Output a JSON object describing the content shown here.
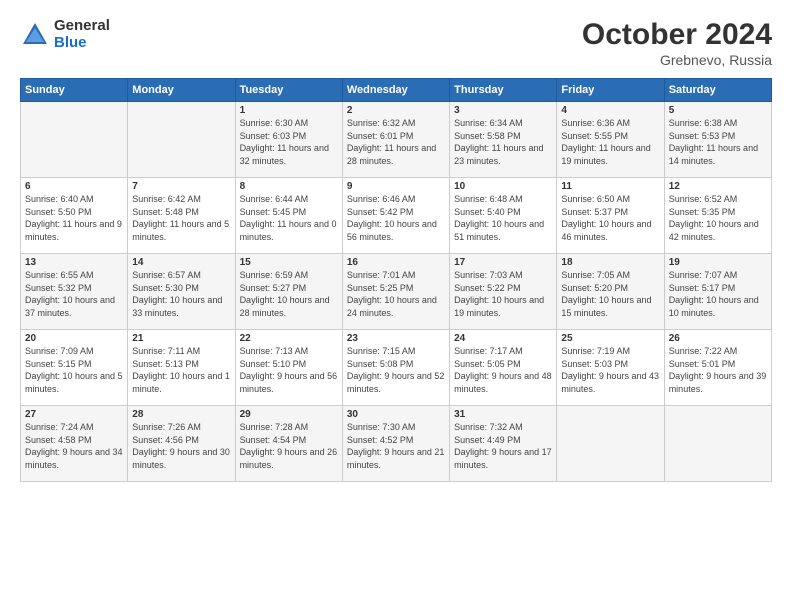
{
  "header": {
    "logo_general": "General",
    "logo_blue": "Blue",
    "month_title": "October 2024",
    "location": "Grebnevo, Russia"
  },
  "days_of_week": [
    "Sunday",
    "Monday",
    "Tuesday",
    "Wednesday",
    "Thursday",
    "Friday",
    "Saturday"
  ],
  "weeks": [
    [
      {
        "day": "",
        "sunrise": "",
        "sunset": "",
        "daylight": ""
      },
      {
        "day": "",
        "sunrise": "",
        "sunset": "",
        "daylight": ""
      },
      {
        "day": "1",
        "sunrise": "Sunrise: 6:30 AM",
        "sunset": "Sunset: 6:03 PM",
        "daylight": "Daylight: 11 hours and 32 minutes."
      },
      {
        "day": "2",
        "sunrise": "Sunrise: 6:32 AM",
        "sunset": "Sunset: 6:01 PM",
        "daylight": "Daylight: 11 hours and 28 minutes."
      },
      {
        "day": "3",
        "sunrise": "Sunrise: 6:34 AM",
        "sunset": "Sunset: 5:58 PM",
        "daylight": "Daylight: 11 hours and 23 minutes."
      },
      {
        "day": "4",
        "sunrise": "Sunrise: 6:36 AM",
        "sunset": "Sunset: 5:55 PM",
        "daylight": "Daylight: 11 hours and 19 minutes."
      },
      {
        "day": "5",
        "sunrise": "Sunrise: 6:38 AM",
        "sunset": "Sunset: 5:53 PM",
        "daylight": "Daylight: 11 hours and 14 minutes."
      }
    ],
    [
      {
        "day": "6",
        "sunrise": "Sunrise: 6:40 AM",
        "sunset": "Sunset: 5:50 PM",
        "daylight": "Daylight: 11 hours and 9 minutes."
      },
      {
        "day": "7",
        "sunrise": "Sunrise: 6:42 AM",
        "sunset": "Sunset: 5:48 PM",
        "daylight": "Daylight: 11 hours and 5 minutes."
      },
      {
        "day": "8",
        "sunrise": "Sunrise: 6:44 AM",
        "sunset": "Sunset: 5:45 PM",
        "daylight": "Daylight: 11 hours and 0 minutes."
      },
      {
        "day": "9",
        "sunrise": "Sunrise: 6:46 AM",
        "sunset": "Sunset: 5:42 PM",
        "daylight": "Daylight: 10 hours and 56 minutes."
      },
      {
        "day": "10",
        "sunrise": "Sunrise: 6:48 AM",
        "sunset": "Sunset: 5:40 PM",
        "daylight": "Daylight: 10 hours and 51 minutes."
      },
      {
        "day": "11",
        "sunrise": "Sunrise: 6:50 AM",
        "sunset": "Sunset: 5:37 PM",
        "daylight": "Daylight: 10 hours and 46 minutes."
      },
      {
        "day": "12",
        "sunrise": "Sunrise: 6:52 AM",
        "sunset": "Sunset: 5:35 PM",
        "daylight": "Daylight: 10 hours and 42 minutes."
      }
    ],
    [
      {
        "day": "13",
        "sunrise": "Sunrise: 6:55 AM",
        "sunset": "Sunset: 5:32 PM",
        "daylight": "Daylight: 10 hours and 37 minutes."
      },
      {
        "day": "14",
        "sunrise": "Sunrise: 6:57 AM",
        "sunset": "Sunset: 5:30 PM",
        "daylight": "Daylight: 10 hours and 33 minutes."
      },
      {
        "day": "15",
        "sunrise": "Sunrise: 6:59 AM",
        "sunset": "Sunset: 5:27 PM",
        "daylight": "Daylight: 10 hours and 28 minutes."
      },
      {
        "day": "16",
        "sunrise": "Sunrise: 7:01 AM",
        "sunset": "Sunset: 5:25 PM",
        "daylight": "Daylight: 10 hours and 24 minutes."
      },
      {
        "day": "17",
        "sunrise": "Sunrise: 7:03 AM",
        "sunset": "Sunset: 5:22 PM",
        "daylight": "Daylight: 10 hours and 19 minutes."
      },
      {
        "day": "18",
        "sunrise": "Sunrise: 7:05 AM",
        "sunset": "Sunset: 5:20 PM",
        "daylight": "Daylight: 10 hours and 15 minutes."
      },
      {
        "day": "19",
        "sunrise": "Sunrise: 7:07 AM",
        "sunset": "Sunset: 5:17 PM",
        "daylight": "Daylight: 10 hours and 10 minutes."
      }
    ],
    [
      {
        "day": "20",
        "sunrise": "Sunrise: 7:09 AM",
        "sunset": "Sunset: 5:15 PM",
        "daylight": "Daylight: 10 hours and 5 minutes."
      },
      {
        "day": "21",
        "sunrise": "Sunrise: 7:11 AM",
        "sunset": "Sunset: 5:13 PM",
        "daylight": "Daylight: 10 hours and 1 minute."
      },
      {
        "day": "22",
        "sunrise": "Sunrise: 7:13 AM",
        "sunset": "Sunset: 5:10 PM",
        "daylight": "Daylight: 9 hours and 56 minutes."
      },
      {
        "day": "23",
        "sunrise": "Sunrise: 7:15 AM",
        "sunset": "Sunset: 5:08 PM",
        "daylight": "Daylight: 9 hours and 52 minutes."
      },
      {
        "day": "24",
        "sunrise": "Sunrise: 7:17 AM",
        "sunset": "Sunset: 5:05 PM",
        "daylight": "Daylight: 9 hours and 48 minutes."
      },
      {
        "day": "25",
        "sunrise": "Sunrise: 7:19 AM",
        "sunset": "Sunset: 5:03 PM",
        "daylight": "Daylight: 9 hours and 43 minutes."
      },
      {
        "day": "26",
        "sunrise": "Sunrise: 7:22 AM",
        "sunset": "Sunset: 5:01 PM",
        "daylight": "Daylight: 9 hours and 39 minutes."
      }
    ],
    [
      {
        "day": "27",
        "sunrise": "Sunrise: 7:24 AM",
        "sunset": "Sunset: 4:58 PM",
        "daylight": "Daylight: 9 hours and 34 minutes."
      },
      {
        "day": "28",
        "sunrise": "Sunrise: 7:26 AM",
        "sunset": "Sunset: 4:56 PM",
        "daylight": "Daylight: 9 hours and 30 minutes."
      },
      {
        "day": "29",
        "sunrise": "Sunrise: 7:28 AM",
        "sunset": "Sunset: 4:54 PM",
        "daylight": "Daylight: 9 hours and 26 minutes."
      },
      {
        "day": "30",
        "sunrise": "Sunrise: 7:30 AM",
        "sunset": "Sunset: 4:52 PM",
        "daylight": "Daylight: 9 hours and 21 minutes."
      },
      {
        "day": "31",
        "sunrise": "Sunrise: 7:32 AM",
        "sunset": "Sunset: 4:49 PM",
        "daylight": "Daylight: 9 hours and 17 minutes."
      },
      {
        "day": "",
        "sunrise": "",
        "sunset": "",
        "daylight": ""
      },
      {
        "day": "",
        "sunrise": "",
        "sunset": "",
        "daylight": ""
      }
    ]
  ]
}
